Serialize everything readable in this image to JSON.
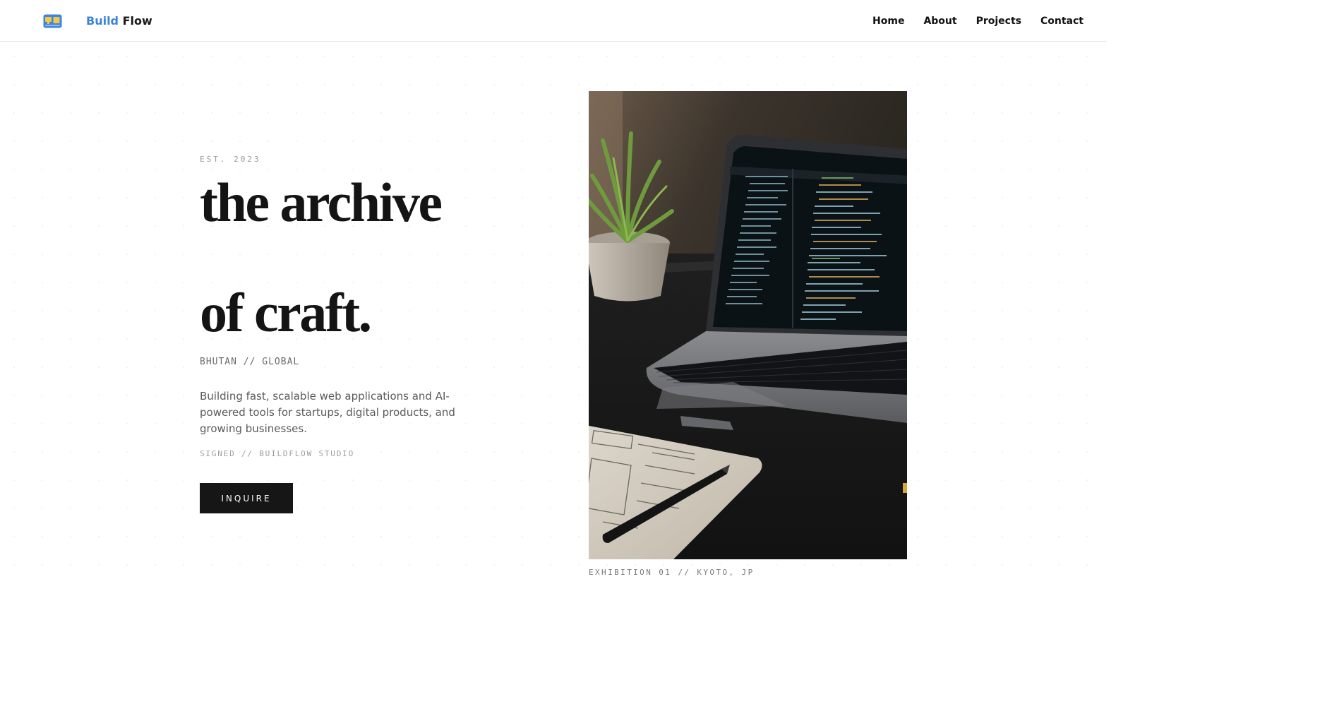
{
  "brand": {
    "part1": "Build",
    "part2": "Flow",
    "icon": "monitor-logo-icon",
    "accent_color": "#3c82d8"
  },
  "nav": {
    "items": [
      {
        "label": "Home"
      },
      {
        "label": "About"
      },
      {
        "label": "Projects"
      },
      {
        "label": "Contact"
      }
    ]
  },
  "hero": {
    "eyebrow": "EST. 2023",
    "headline_line1": "the archive",
    "headline_line2": "of craft.",
    "location": "BHUTAN // GLOBAL",
    "description": "Building fast, scalable web applications and AI-powered tools for startups, digital products, and growing businesses.",
    "signed": "SIGNED // BUILDFLOW STUDIO",
    "cta_label": "INQUIRE"
  },
  "exhibit": {
    "image_icon": "laptop-desk-photo",
    "caption": "EXHIBITION 01 // KYOTO, JP"
  },
  "colors": {
    "text_dark": "#141414",
    "button_bg": "#161616",
    "muted": "#9a9a9a"
  }
}
